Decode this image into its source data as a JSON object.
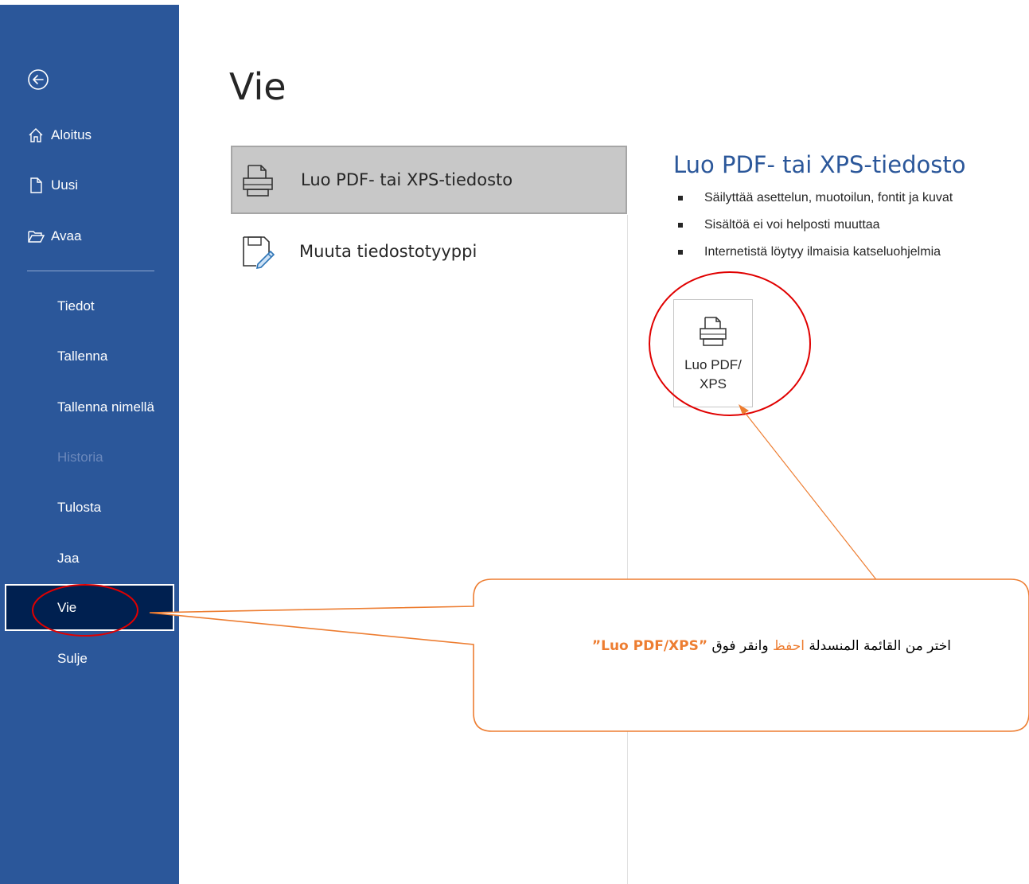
{
  "sidebar": {
    "items": [
      {
        "label": "Aloitus"
      },
      {
        "label": "Uusi"
      },
      {
        "label": "Avaa"
      },
      {
        "label": "Tiedot"
      },
      {
        "label": "Tallenna"
      },
      {
        "label": "Tallenna nimellä"
      },
      {
        "label": "Historia",
        "disabled": true
      },
      {
        "label": "Tulosta"
      },
      {
        "label": "Jaa"
      },
      {
        "label": "Vie",
        "selected": true
      },
      {
        "label": "Sulje"
      }
    ]
  },
  "main": {
    "title": "Vie",
    "options": [
      {
        "label": "Luo PDF- tai XPS-tiedosto",
        "selected": true
      },
      {
        "label": "Muuta tiedostotyyppi"
      }
    ],
    "detail": {
      "title": "Luo PDF- tai XPS-tiedosto",
      "bullets": [
        "Säilyttää asettelun, muotoilun, fontit ja kuvat",
        "Sisältöä ei voi helposti muuttaa",
        "Internetistä löytyy ilmaisia katseluohjelmia"
      ],
      "button_label": "Luo PDF/\nXPS"
    }
  },
  "callout": {
    "text_before": "اختر من القائمة المنسدلة ",
    "highlight": "احفظ",
    "text_after": " وانقر فوق ",
    "quoted": "”Luo PDF/XPS”"
  },
  "colors": {
    "sidebar_bg": "#2b579a",
    "selected_bg": "#002050",
    "accent_title": "#2b579a",
    "annotation_orange": "#ed7d31",
    "annotation_red": "#e00000"
  }
}
